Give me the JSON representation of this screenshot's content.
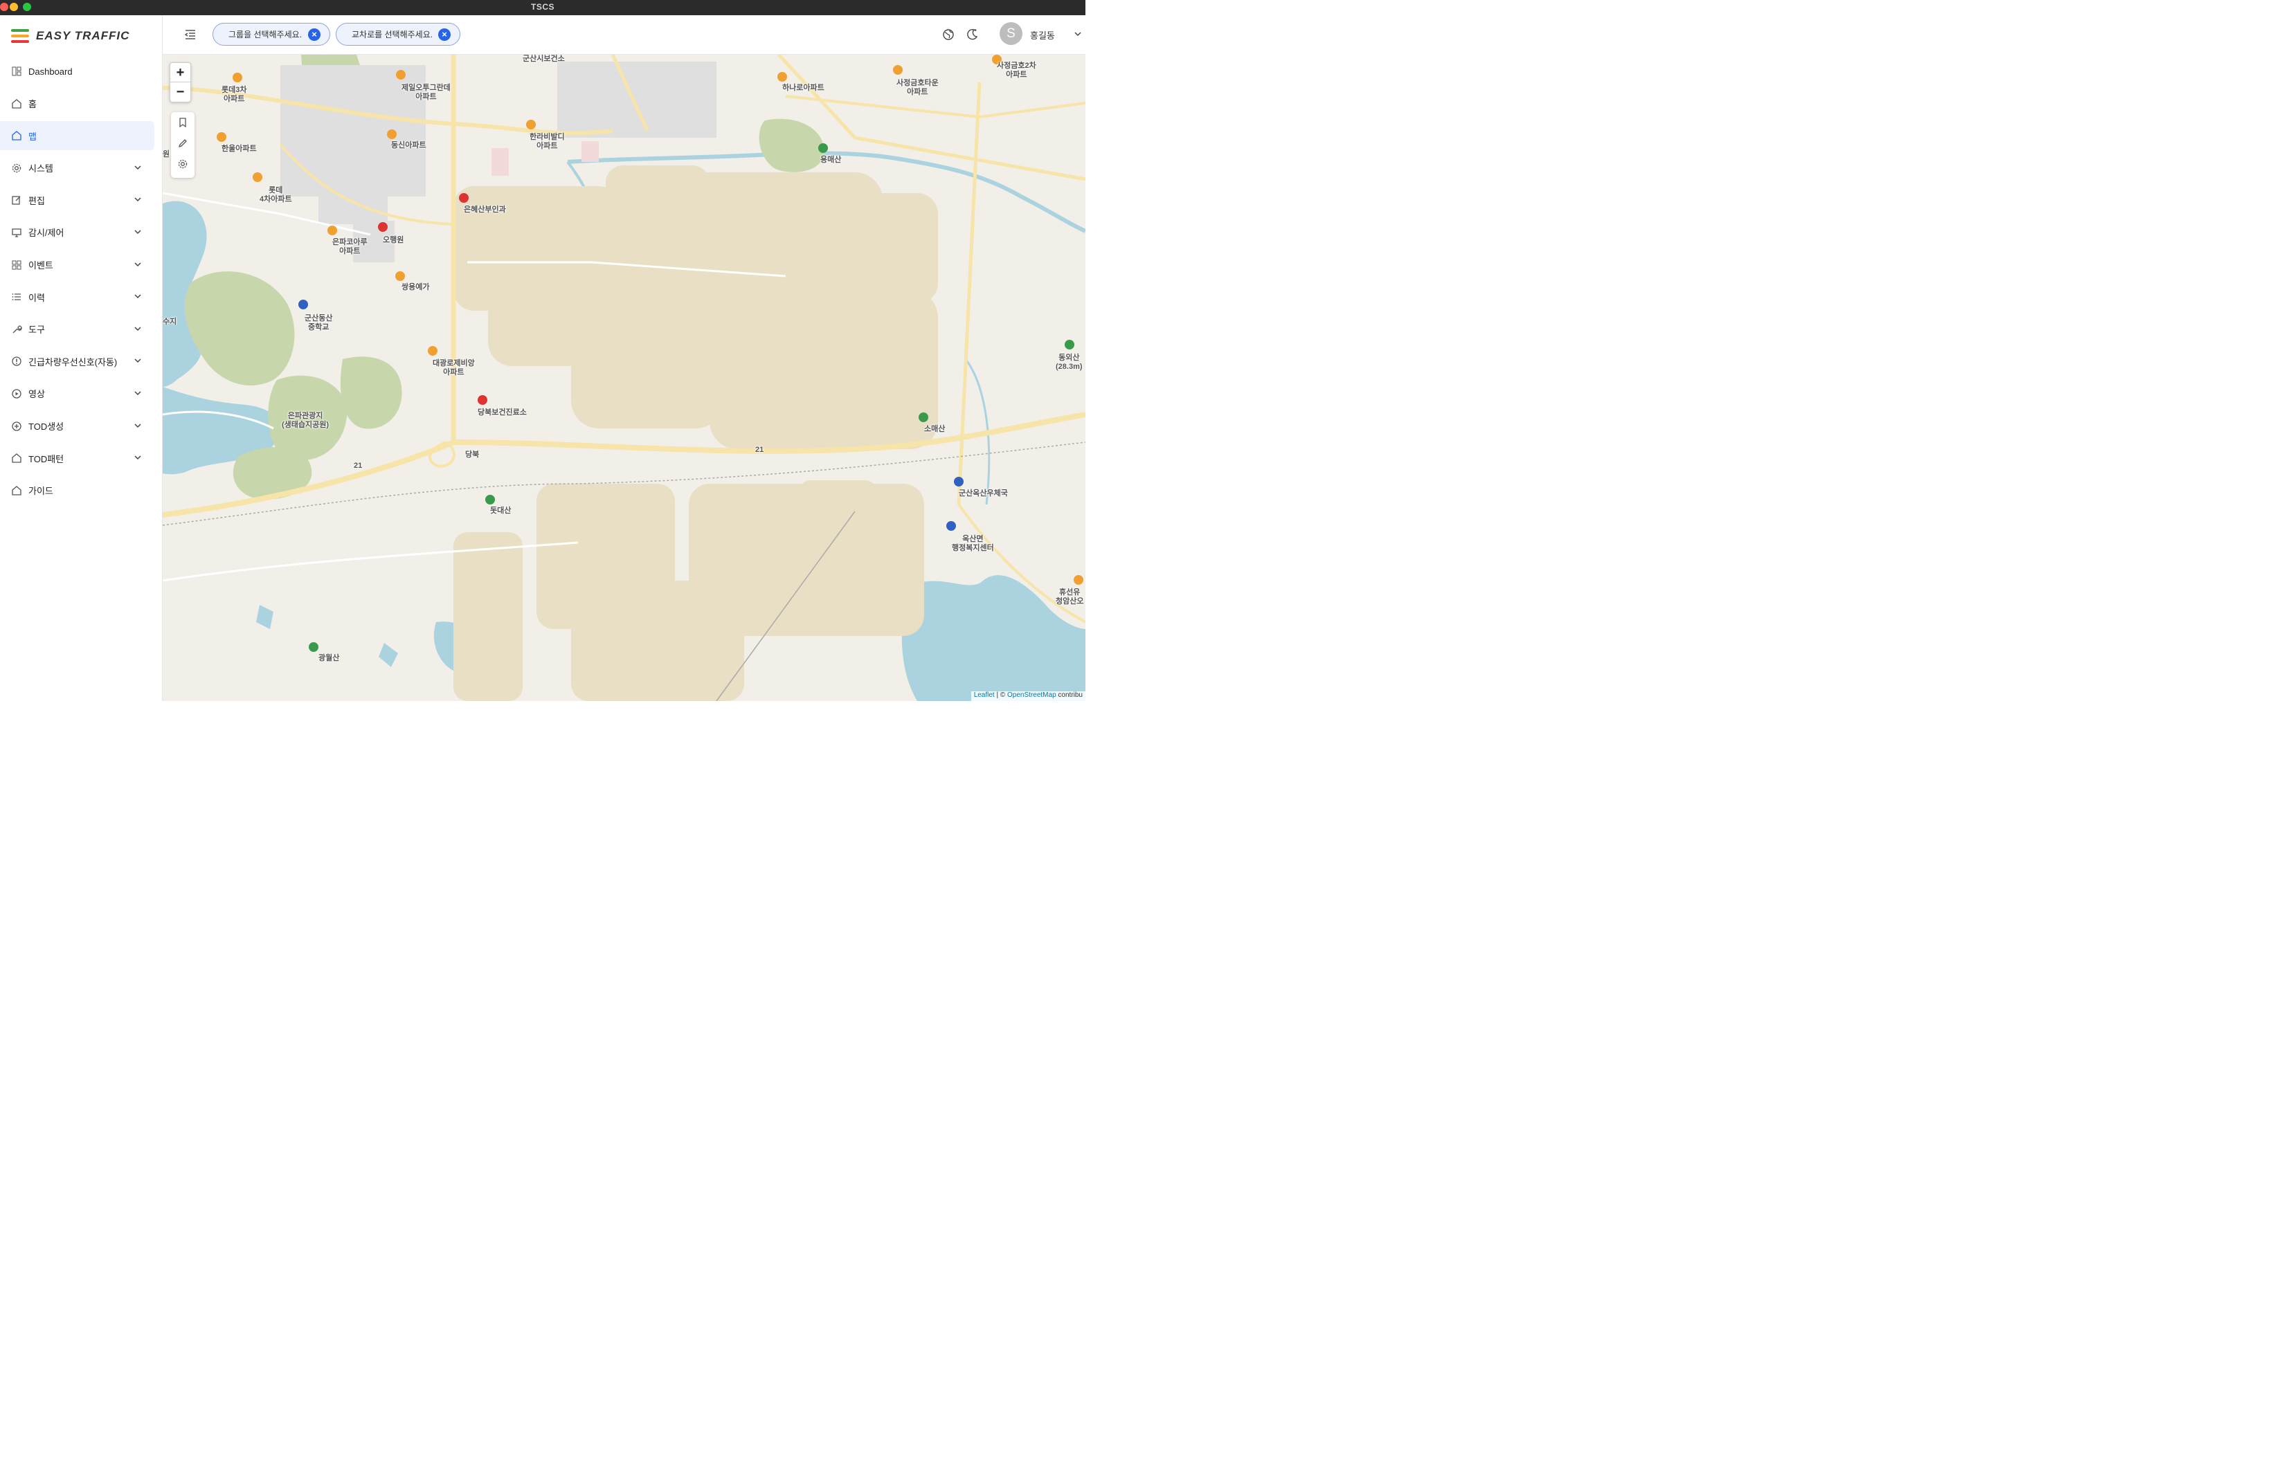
{
  "window": {
    "title": "TSCS"
  },
  "brand": {
    "name": "EASY TRAFFIC",
    "colors": [
      "#e53935",
      "#f9a825",
      "#43a047"
    ]
  },
  "sidebar": {
    "items": [
      {
        "label": "Dashboard",
        "icon": "dashboard-icon",
        "expandable": false,
        "active": false
      },
      {
        "label": "홈",
        "icon": "home-icon",
        "expandable": false,
        "active": false
      },
      {
        "label": "맵",
        "icon": "home-icon",
        "expandable": false,
        "active": true
      },
      {
        "label": "시스템",
        "icon": "gear-icon",
        "expandable": true,
        "active": false
      },
      {
        "label": "편집",
        "icon": "edit-icon",
        "expandable": true,
        "active": false
      },
      {
        "label": "감시/제어",
        "icon": "monitor-icon",
        "expandable": true,
        "active": false
      },
      {
        "label": "이벤트",
        "icon": "grid-icon",
        "expandable": true,
        "active": false
      },
      {
        "label": "이력",
        "icon": "list-icon",
        "expandable": true,
        "active": false
      },
      {
        "label": "도구",
        "icon": "tool-icon",
        "expandable": true,
        "active": false
      },
      {
        "label": "긴급차량우선신호(자동)",
        "icon": "alert-icon",
        "expandable": true,
        "active": false
      },
      {
        "label": "영상",
        "icon": "play-icon",
        "expandable": true,
        "active": false
      },
      {
        "label": "TOD생성",
        "icon": "plus-circle-icon",
        "expandable": true,
        "active": false
      },
      {
        "label": "TOD패턴",
        "icon": "home-icon",
        "expandable": true,
        "active": false
      },
      {
        "label": "가이드",
        "icon": "home-icon",
        "expandable": false,
        "active": false
      }
    ]
  },
  "topbar": {
    "group_chip": "그룹을 선택해주세요.",
    "intersection_chip": "교차로를 선택해주세요.",
    "user": {
      "initial": "S",
      "name": "홍길동"
    }
  },
  "map": {
    "zoom_in": "+",
    "zoom_out": "−",
    "attribution_leaflet": "Leaflet",
    "attribution_rest": " | © ",
    "attribution_osm": "OpenStreetMap",
    "attribution_tail": " contribu",
    "labels": [
      "군산시보건소",
      "롯데3차\n아파트",
      "제일오투그란데\n아파트",
      "하나로아파트",
      "사정금호타운\n아파트",
      "사정금호2차\n아파트",
      "한울아파트",
      "동신아파트",
      "한라비발디\n아파트",
      "용매산",
      "롯데\n4차아파트",
      "은혜산부인과",
      "은파코아루\n아파트",
      "오행원",
      "쌍용예가",
      "수지",
      "군산동산\n중학교",
      "대광로제비앙\n아파트",
      "동외산\n(28.3m)",
      "은파관광지\n(생태습지공원)",
      "당북보건진료소",
      "소매산",
      "당북",
      "군산옥산우체국",
      "돗대산",
      "옥산면\n행정복지센터",
      "휴선유\n청암산오",
      "광월산",
      "원",
      "21",
      "21"
    ]
  }
}
